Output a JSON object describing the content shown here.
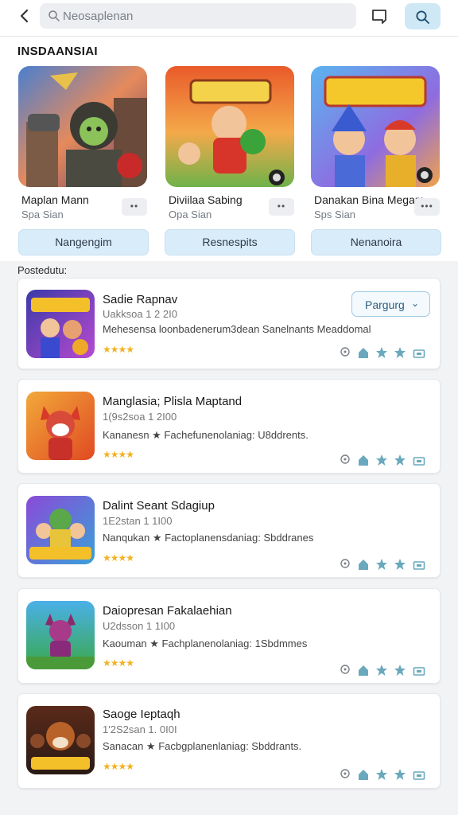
{
  "header": {
    "search_placeholder": "Neosaplenan",
    "icons": [
      "back-chevron-icon",
      "search-icon",
      "chat-bubble-icon",
      "search-button-icon"
    ]
  },
  "featured": {
    "title": "INSDAANSIAI",
    "items": [
      {
        "name": "Maplan Mann",
        "sub": "Spa Sian",
        "more": "••",
        "button": "Nangengim"
      },
      {
        "name": "Diviilaa Sabing",
        "sub": "Opa Sian",
        "more": "••",
        "button": "Resnespits"
      },
      {
        "name": "Danakan Bina Megam",
        "sub": "Sps Sian",
        "more": "•••",
        "button": "Nenanoira"
      }
    ]
  },
  "list": {
    "title": "Postedutu:",
    "items": [
      {
        "title": "Sadie Rapnav",
        "meta": "Uakksoa 1 2 2I0",
        "desc": "Mehesensa loonbadenerum3dean Sanelnants Meaddomal",
        "stars": "★★★★",
        "icon_text": "NEAKSAN",
        "action": "Pargurg",
        "chevron": "⌄"
      },
      {
        "title": "Manglasia; Plisla Maptand",
        "meta": "1(9s2soa 1 2I00",
        "desc": "Kananesn ★ Fachefunenolaniag: U8ddrents.",
        "stars": "★★★★",
        "icon_text": ""
      },
      {
        "title": "Dalint Seant Sdagiup",
        "meta": "1E2stan 1 1I00",
        "desc": "Nanqukan ★ Factoplanensdaniag: Sbddranes",
        "stars": "★★★★",
        "icon_text": "NNGOUS"
      },
      {
        "title": "Daiopresan Fakalaehian",
        "meta": "U2dsson 1 1I00",
        "desc": "Kaouman ★ Fachplanenolaniag: 1Sbdmmes",
        "stars": "★★★★",
        "icon_text": ""
      },
      {
        "title": "Saoge Ieptaqh",
        "meta": "1'2S2san 1. 0I0I",
        "desc": "Sanacan ★ Facbgplanenlaniag: Sbddrants.",
        "stars": "★★★★",
        "icon_text": "QUSAMO"
      }
    ]
  },
  "colors": {
    "accent": "#cfe8f6",
    "button_bg": "#d9ecf9",
    "star": "#f2b220",
    "action_icon": "#6aa9bd"
  }
}
